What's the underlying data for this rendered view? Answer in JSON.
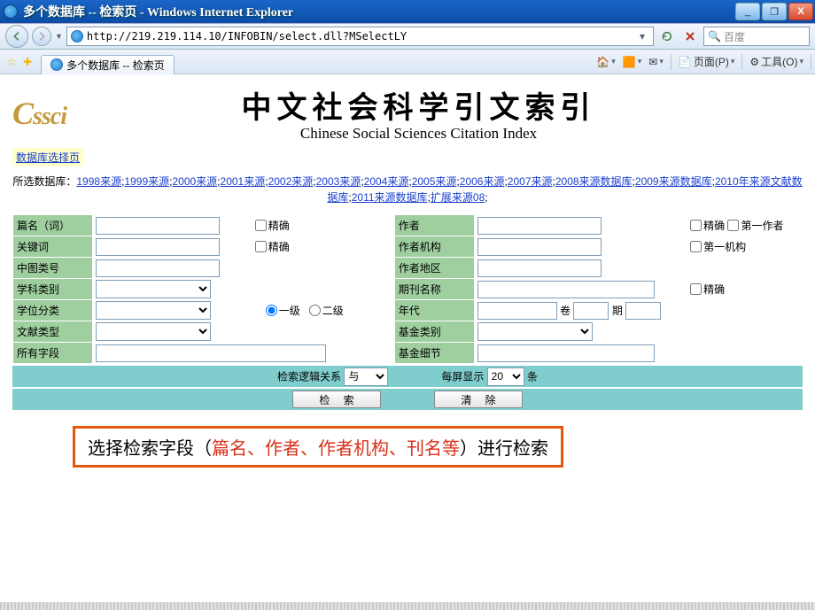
{
  "window": {
    "title": "多个数据库 -- 检索页 - Windows Internet Explorer",
    "url": "http://219.219.114.10/INFOBIN/select.dll?MSelectLY",
    "search_placeholder": "百度",
    "minimize": "_",
    "maximize": "❐",
    "close": "X"
  },
  "tab": {
    "label": "多个数据库 -- 检索页"
  },
  "toolbar": {
    "home": "▾",
    "rss": "▾",
    "mail": "▾",
    "page": "页面(P)",
    "tools": "工具(O)"
  },
  "page": {
    "logo": "Cssci",
    "title_cn": "中文社会科学引文索引",
    "title_en": "Chinese Social Sciences Citation Index",
    "dblink": "数据库选择页",
    "db_label": "所选数据库：",
    "dbs": [
      "1998来源",
      "1999来源",
      "2000来源",
      "2001来源",
      "2002来源",
      "2003来源",
      "2004来源",
      "2005来源",
      "2006来源",
      "2007来源",
      "2008来源数据库",
      "2009来源数据库",
      "2010年来源文献数据库",
      "2011来源数据库",
      "扩展来源08"
    ]
  },
  "form": {
    "left": {
      "篇名": {
        "label": "篇名（词）",
        "chk": "精确"
      },
      "关键词": {
        "label": "关键词",
        "chk": "精确"
      },
      "中图类号": {
        "label": "中图类号"
      },
      "学科类别": {
        "label": "学科类别"
      },
      "学位分类": {
        "label": "学位分类",
        "r1": "一级",
        "r2": "二级"
      },
      "文献类型": {
        "label": "文献类型"
      },
      "所有字段": {
        "label": "所有字段"
      }
    },
    "right": {
      "作者": {
        "label": "作者",
        "chk1": "精确",
        "chk2": "第一作者"
      },
      "作者机构": {
        "label": "作者机构",
        "chk": "第一机构"
      },
      "作者地区": {
        "label": "作者地区"
      },
      "期刊名称": {
        "label": "期刊名称",
        "chk": "精确"
      },
      "年代": {
        "label": "年代",
        "vol": "卷",
        "issue": "期"
      },
      "基金类别": {
        "label": "基金类别"
      },
      "基金细节": {
        "label": "基金细节"
      }
    },
    "logic_label": "检索逻辑关系",
    "logic_val": "与",
    "perpage_label": "每屏显示",
    "perpage_val": "20",
    "perpage_unit": "条",
    "btn_search": "检 索",
    "btn_clear": "清 除"
  },
  "annotation": {
    "t1": "选择检索字段（",
    "t2": "篇名、作者、作者机构、刊名等",
    "t3": "）进行检索"
  }
}
